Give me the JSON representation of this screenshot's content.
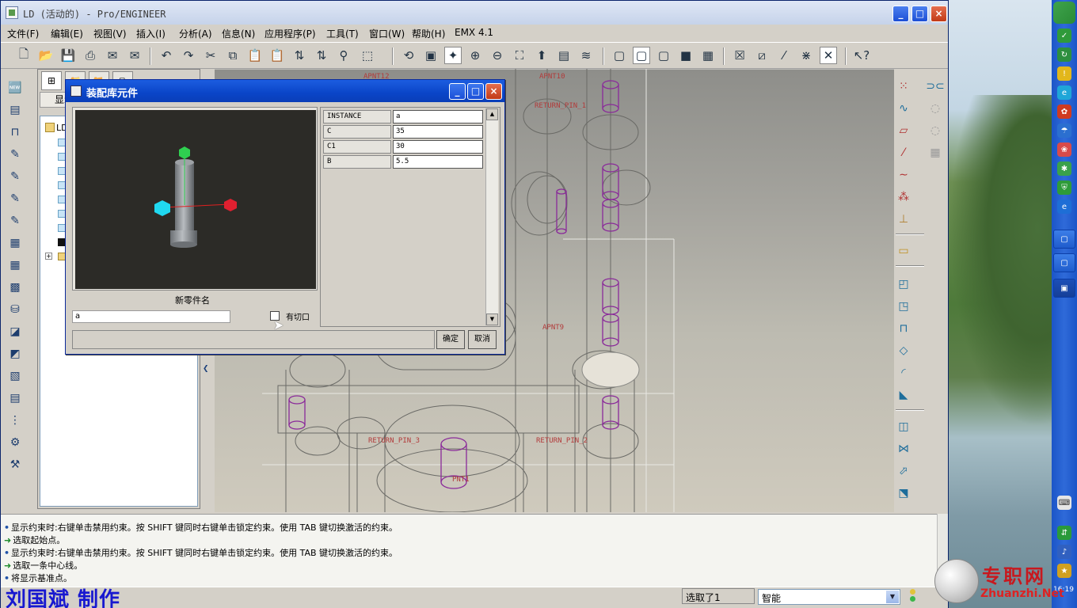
{
  "window": {
    "title": "LD (活动的) - Pro/ENGINEER",
    "minimize_label": "_",
    "maximize_label": "□",
    "close_label": "×"
  },
  "menu": {
    "items": [
      "文件(F)",
      "编辑(E)",
      "视图(V)",
      "插入(I)",
      "分析(A)",
      "信息(N)",
      "应用程序(P)",
      "工具(T)",
      "窗口(W)",
      "帮助(H)",
      "EMX 4.1"
    ]
  },
  "toolbar": {
    "icons": [
      "new-icon",
      "open-icon",
      "save-icon",
      "print-icon",
      "send-icon",
      "send2-icon",
      "undo-icon",
      "redo-icon",
      "cut-icon",
      "copy-icon",
      "paste-icon",
      "paste-special-icon",
      "regenerate-icon",
      "regen-manager-icon",
      "find-icon",
      "select-box-icon",
      "orient-icon",
      "view-manager-icon",
      "spin-center-icon",
      "zoom-in-icon",
      "zoom-out-icon",
      "refit-icon",
      "reorient-icon",
      "saved-views-icon",
      "layers-icon",
      "wireframe-icon",
      "hidden-line-icon",
      "no-hidden-icon",
      "shading-icon",
      "enhanced-realism-icon",
      "datum-plane-icon",
      "datum-axis-icon",
      "datum-point-icon",
      "datum-csys-icon",
      "context-help-icon"
    ]
  },
  "tree": {
    "show_label": "显示",
    "root_label": "LD"
  },
  "graphics": {
    "labels": [
      "APNT12",
      "APNT10",
      "RETURN_PIN_1",
      "APNT9",
      "RETURN_PIN_3",
      "RETURN_PIN_2",
      "PNT1"
    ]
  },
  "dialog": {
    "title": "装配库元件",
    "new_name_label": "新零件名",
    "new_name_value": "a",
    "cut_label": "有切口",
    "ok_label": "确定",
    "cancel_label": "取消",
    "params": [
      {
        "name": "INSTANCE",
        "value": "a"
      },
      {
        "name": "C",
        "value": "35"
      },
      {
        "name": "C1",
        "value": "30"
      },
      {
        "name": "B",
        "value": "5.5"
      }
    ]
  },
  "messages": [
    {
      "type": "info",
      "text": "显示约束时:右键单击禁用约束。按 SHIFT 键同时右键单击锁定约束。使用 TAB 键切换激活的约束。"
    },
    {
      "type": "prompt",
      "text": "选取起始点。"
    },
    {
      "type": "info",
      "text": "显示约束时:右键单击禁用约束。按 SHIFT 键同时右键单击锁定约束。使用 TAB 键切换激活的约束。"
    },
    {
      "type": "prompt",
      "text": "选取一条中心线。"
    },
    {
      "type": "info",
      "text": "将显示基准点。"
    }
  ],
  "status": {
    "author": "刘国斌 制作",
    "selected_text": "选取了1",
    "filter_value": "智能"
  },
  "watermark": {
    "cn": "专职网",
    "en": "Zhuanzhi.Net"
  },
  "taskbar": {
    "time": "16:19"
  }
}
